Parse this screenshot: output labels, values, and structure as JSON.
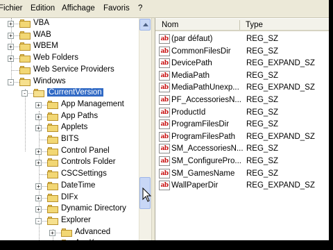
{
  "menu": [
    "Fichier",
    "Edition",
    "Affichage",
    "Favoris",
    "?"
  ],
  "tree": [
    {
      "label": "VBA",
      "expander": "+",
      "level": 1
    },
    {
      "label": "WAB",
      "expander": "+",
      "level": 1
    },
    {
      "label": "WBEM",
      "expander": "+",
      "level": 1
    },
    {
      "label": "Web Folders",
      "expander": "+",
      "level": 1
    },
    {
      "label": "Web Service Providers",
      "expander": "",
      "level": 1
    },
    {
      "label": "Windows",
      "expander": "-",
      "level": 1
    },
    {
      "label": "CurrentVersion",
      "expander": "-",
      "level": 2,
      "selected": true
    },
    {
      "label": "App Management",
      "expander": "+",
      "level": 3
    },
    {
      "label": "App Paths",
      "expander": "+",
      "level": 3
    },
    {
      "label": "Applets",
      "expander": "+",
      "level": 3
    },
    {
      "label": "BITS",
      "expander": "",
      "level": 3
    },
    {
      "label": "Control Panel",
      "expander": "+",
      "level": 3
    },
    {
      "label": "Controls Folder",
      "expander": "+",
      "level": 3
    },
    {
      "label": "CSCSettings",
      "expander": "",
      "level": 3
    },
    {
      "label": "DateTime",
      "expander": "+",
      "level": 3
    },
    {
      "label": "DIFx",
      "expander": "+",
      "level": 3
    },
    {
      "label": "Dynamic Directory",
      "expander": "+",
      "level": 3
    },
    {
      "label": "Explorer",
      "expander": "-",
      "level": 3
    },
    {
      "label": "Advanced",
      "expander": "+",
      "level": 4
    },
    {
      "label": "AppKey",
      "expander": "+",
      "level": 4
    }
  ],
  "list": {
    "columns": {
      "name": "Nom",
      "type": "Type"
    },
    "rows": [
      {
        "name": "(par défaut)",
        "type": "REG_SZ"
      },
      {
        "name": "CommonFilesDir",
        "type": "REG_SZ"
      },
      {
        "name": "DevicePath",
        "type": "REG_EXPAND_SZ"
      },
      {
        "name": "MediaPath",
        "type": "REG_SZ"
      },
      {
        "name": "MediaPathUnexp...",
        "type": "REG_EXPAND_SZ"
      },
      {
        "name": "PF_AccessoriesN...",
        "type": "REG_SZ"
      },
      {
        "name": "ProductId",
        "type": "REG_SZ"
      },
      {
        "name": "ProgramFilesDir",
        "type": "REG_SZ"
      },
      {
        "name": "ProgramFilesPath",
        "type": "REG_EXPAND_SZ"
      },
      {
        "name": "SM_AccessoriesN...",
        "type": "REG_SZ"
      },
      {
        "name": "SM_ConfigurePro...",
        "type": "REG_SZ"
      },
      {
        "name": "SM_GamesName",
        "type": "REG_SZ"
      },
      {
        "name": "WallPaperDir",
        "type": "REG_EXPAND_SZ"
      }
    ],
    "value_icon_text": "ab"
  },
  "colors": {
    "selection": "#316ac5",
    "value_icon_red": "#c81010"
  },
  "icons": {
    "tree_expander": "plus-minus-box-icon",
    "tree_folder": "folder-icon",
    "value_type": "string-value-icon",
    "cursor": "mouse-pointer-icon"
  }
}
